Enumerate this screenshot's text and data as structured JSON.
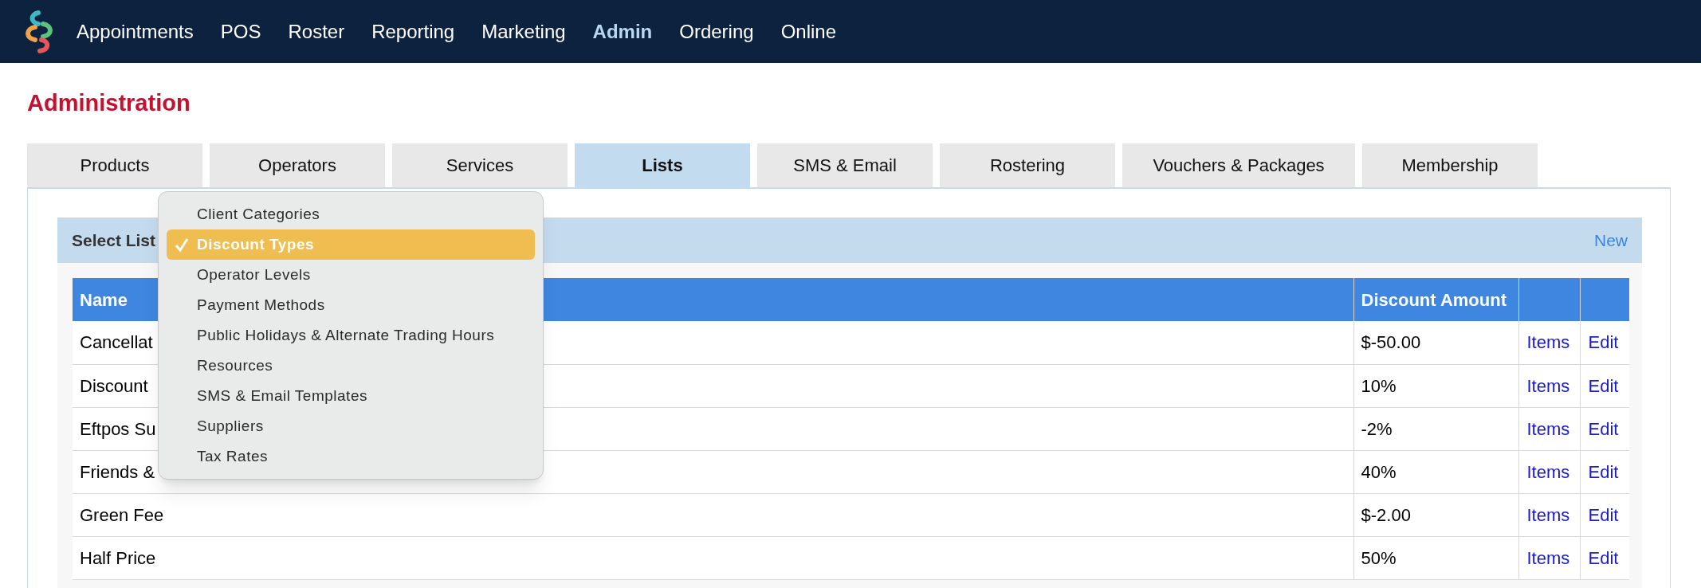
{
  "nav": {
    "items": [
      {
        "label": "Appointments",
        "selected": false
      },
      {
        "label": "POS",
        "selected": false
      },
      {
        "label": "Roster",
        "selected": false
      },
      {
        "label": "Reporting",
        "selected": false
      },
      {
        "label": "Marketing",
        "selected": false
      },
      {
        "label": "Admin",
        "selected": true
      },
      {
        "label": "Ordering",
        "selected": false
      },
      {
        "label": "Online",
        "selected": false
      }
    ]
  },
  "page_title": "Administration",
  "tabs": [
    {
      "label": "Products",
      "selected": false
    },
    {
      "label": "Operators",
      "selected": false
    },
    {
      "label": "Services",
      "selected": false
    },
    {
      "label": "Lists",
      "selected": true
    },
    {
      "label": "SMS & Email",
      "selected": false
    },
    {
      "label": "Rostering",
      "selected": false
    },
    {
      "label": "Vouchers & Packages",
      "selected": false
    },
    {
      "label": "Membership",
      "selected": false
    }
  ],
  "list_bar": {
    "label": "Select List",
    "new_link": "New"
  },
  "dropdown": {
    "options": [
      {
        "label": "Client Categories",
        "selected": false
      },
      {
        "label": "Discount Types",
        "selected": true
      },
      {
        "label": "Operator Levels",
        "selected": false
      },
      {
        "label": "Payment Methods",
        "selected": false
      },
      {
        "label": "Public Holidays & Alternate Trading Hours",
        "selected": false
      },
      {
        "label": "Resources",
        "selected": false
      },
      {
        "label": "SMS & Email Templates",
        "selected": false
      },
      {
        "label": "Suppliers",
        "selected": false
      },
      {
        "label": "Tax Rates",
        "selected": false
      }
    ]
  },
  "table": {
    "columns": [
      "Name",
      "Discount Amount"
    ],
    "rows": [
      {
        "name": "Cancellat",
        "amount": "$-50.00",
        "items": "Items",
        "edit": "Edit"
      },
      {
        "name": "Discount",
        "amount": "10%",
        "items": "Items",
        "edit": "Edit"
      },
      {
        "name": "Eftpos Su",
        "amount": "-2%",
        "items": "Items",
        "edit": "Edit"
      },
      {
        "name": "Friends &",
        "amount": "40%",
        "items": "Items",
        "edit": "Edit"
      },
      {
        "name": "Green Fee",
        "amount": "$-2.00",
        "items": "Items",
        "edit": "Edit"
      },
      {
        "name": "Half Price",
        "amount": "50%",
        "items": "Items",
        "edit": "Edit"
      }
    ]
  }
}
